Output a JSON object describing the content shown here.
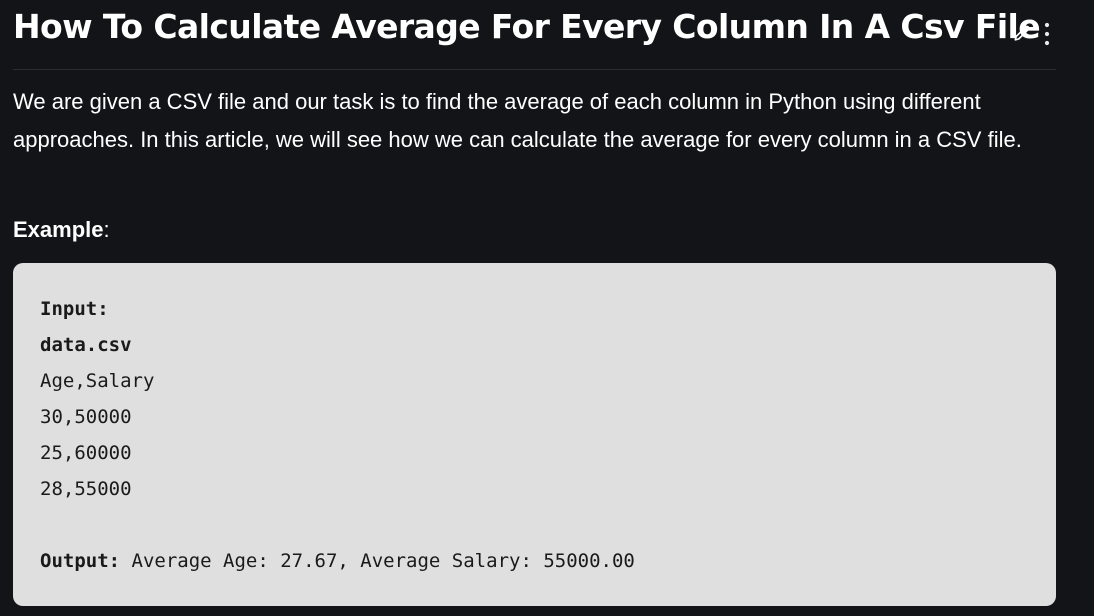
{
  "article": {
    "title": "How To Calculate Average For Every Column In A Csv File",
    "intro": "We are given a CSV file and our task is to find the average of each column in Python using different approaches. In this article, we will see how we can calculate the average for every column in a CSV file.",
    "example_label": "Example",
    "example_suffix": ":"
  },
  "actions": {
    "edit_icon": "pencil-icon",
    "more_icon": "vertical-dots-icon"
  },
  "code": {
    "input_label": "Input:",
    "filename": "data.csv",
    "lines": [
      "Age,Salary",
      "30,50000",
      "25,60000",
      "28,55000"
    ],
    "output_label": "Output:",
    "output_value": " Average Age: 27.67, Average Salary: 55000.00"
  },
  "colors": {
    "background": "#131417",
    "code_background": "#dfdfdf",
    "text": "#ffffff",
    "code_text": "#1a1a1a"
  }
}
